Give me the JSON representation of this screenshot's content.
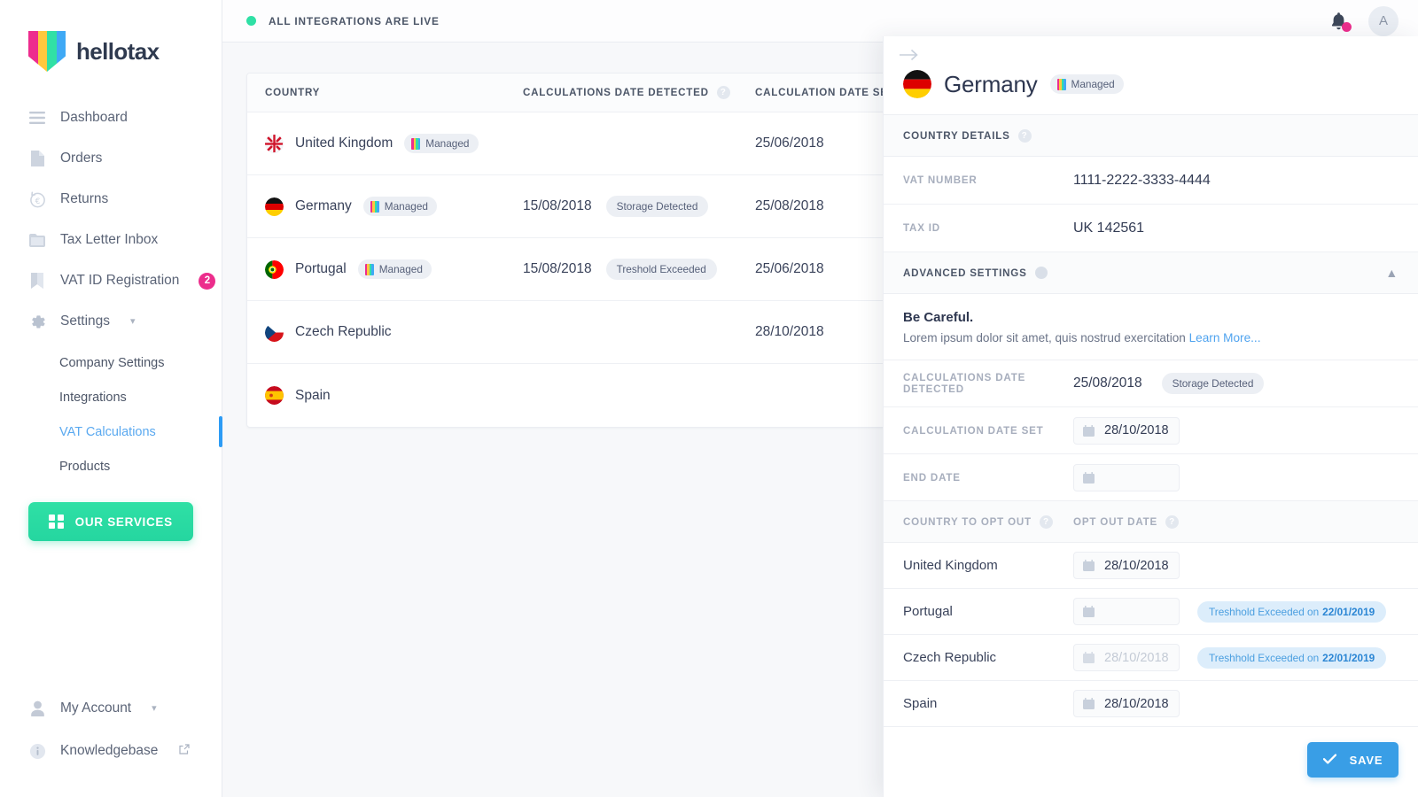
{
  "brand": {
    "name": "hellotax",
    "colors": [
      "#ed2d8e",
      "#ffc83d",
      "#31e0a5",
      "#3fa9f5"
    ]
  },
  "topbar": {
    "status_text": "ALL INTEGRATIONS ARE LIVE",
    "status_color": "#2fe0a5",
    "notification_badge_color": "#ec2d8c",
    "avatar_initial": "A"
  },
  "sidebar": {
    "items": [
      {
        "label": "Dashboard",
        "icon": "menu-icon"
      },
      {
        "label": "Orders",
        "icon": "document-icon"
      },
      {
        "label": "Returns",
        "icon": "euro-return-icon"
      },
      {
        "label": "Tax Letter Inbox",
        "icon": "folder-icon"
      },
      {
        "label": "VAT ID Registration",
        "icon": "bookmark-icon",
        "badge": "2"
      },
      {
        "label": "Settings",
        "icon": "gear-icon",
        "expandable": true
      }
    ],
    "subitems": [
      {
        "label": "Company Settings",
        "active": false
      },
      {
        "label": "Integrations",
        "active": false
      },
      {
        "label": "VAT Calculations",
        "active": true
      },
      {
        "label": "Products",
        "active": false
      }
    ],
    "services_button": "OUR SERVICES",
    "bottom": [
      {
        "label": "My Account",
        "icon": "user-icon",
        "expandable": true
      },
      {
        "label": "Knowledgebase",
        "icon": "info-icon",
        "external": true
      }
    ]
  },
  "table": {
    "columns": [
      {
        "key": "country",
        "label": "COUNTRY",
        "help": false
      },
      {
        "key": "detected",
        "label": "CALCULATIONS DATE DETECTED",
        "help": true
      },
      {
        "key": "dateset",
        "label": "CALCULATION DATE SET",
        "help": true
      }
    ],
    "rows": [
      {
        "country": "United Kingdom",
        "flag": "gb",
        "managed": "Managed",
        "detected": "",
        "status": "",
        "dateset": "25/06/2018"
      },
      {
        "country": "Germany",
        "flag": "de",
        "managed": "Managed",
        "detected": "15/08/2018",
        "status": "Storage Detected",
        "dateset": "25/08/2018"
      },
      {
        "country": "Portugal",
        "flag": "pt",
        "managed": "Managed",
        "detected": "15/08/2018",
        "status": "Treshold Exceeded",
        "dateset": "25/06/2018"
      },
      {
        "country": "Czech Republic",
        "flag": "cz",
        "managed": "",
        "detected": "",
        "status": "",
        "dateset": "28/10/2018"
      },
      {
        "country": "Spain",
        "flag": "es",
        "managed": "",
        "detected": "",
        "status": "",
        "dateset": ""
      }
    ]
  },
  "panel": {
    "back_arrow": "arrow-right-icon",
    "country": "Germany",
    "country_flag": "de",
    "managed_badge": "Managed",
    "country_details_header": "COUNTRY DETAILS",
    "details": [
      {
        "label": "VAT NUMBER",
        "value": "1111-2222-3333-4444"
      },
      {
        "label": "TAX ID",
        "value": "UK 142561"
      }
    ],
    "advanced_header": "ADVANCED SETTINGS",
    "warning": {
      "title": "Be Careful.",
      "body": "Lorem ipsum dolor sit amet, quis nostrud exercitation",
      "link": "Learn More..."
    },
    "advanced": {
      "detected_label": "CALCULATIONS DATE DETECTED",
      "detected_value": "25/08/2018",
      "detected_status": "Storage Detected",
      "dateset_label": "CALCULATION DATE SET",
      "dateset_value": "28/10/2018",
      "enddate_label": "END DATE",
      "enddate_value": ""
    },
    "optout": {
      "col_country": "COUNTRY TO OPT OUT",
      "col_date": "OPT OUT DATE",
      "rows": [
        {
          "country": "United Kingdom",
          "date": "28/10/2018",
          "date_muted": false,
          "note": "",
          "note_date": ""
        },
        {
          "country": "Portugal",
          "date": "",
          "date_muted": false,
          "note": "Treshhold Exceeded on",
          "note_date": "22/01/2019"
        },
        {
          "country": "Czech Republic",
          "date": "28/10/2018",
          "date_muted": true,
          "note": "Treshhold Exceeded on",
          "note_date": "22/01/2019"
        },
        {
          "country": "Spain",
          "date": "28/10/2018",
          "date_muted": false,
          "note": "",
          "note_date": ""
        }
      ]
    },
    "save_label": "SAVE",
    "save_color": "#399ee6"
  }
}
